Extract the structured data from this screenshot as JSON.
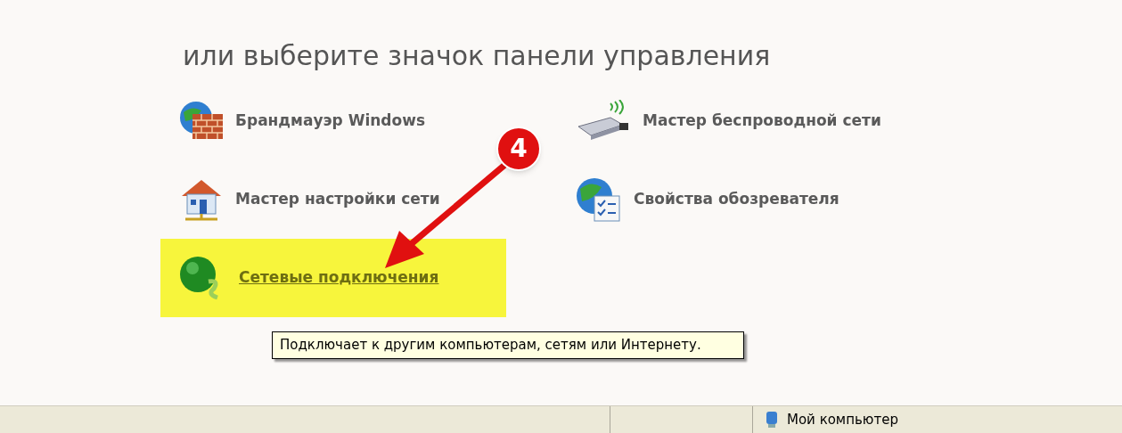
{
  "heading": "или выберите значок панели управления",
  "items": [
    {
      "kind": "firewall",
      "label": "Брандмауэр Windows",
      "selected": false
    },
    {
      "kind": "wireless",
      "label": "Мастер беспроводной сети",
      "selected": false
    },
    {
      "kind": "setup",
      "label": "Мастер настройки сети",
      "selected": false
    },
    {
      "kind": "browser",
      "label": "Свойства обозревателя",
      "selected": false
    },
    {
      "kind": "connections",
      "label": "Сетевые подключения",
      "selected": true
    }
  ],
  "annotation": {
    "step": "4"
  },
  "tooltip": {
    "text": "Подключает к другим компьютерам, сетям или Интернету."
  },
  "status_bar": {
    "zone": "Мой компьютер"
  }
}
